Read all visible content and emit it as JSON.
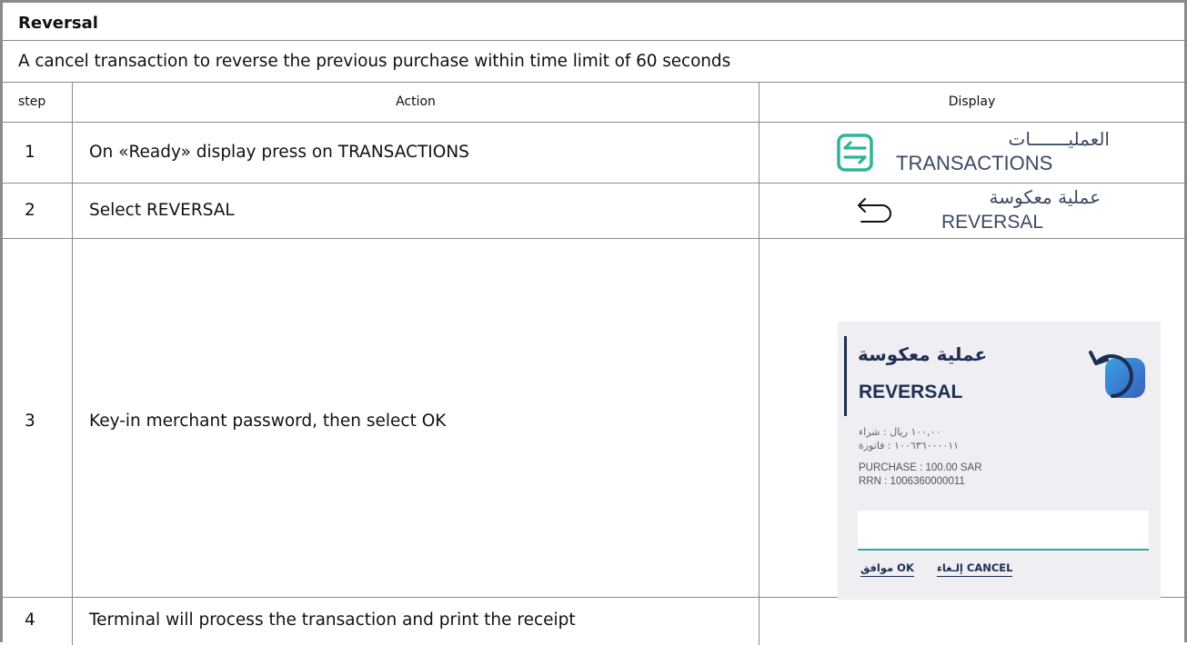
{
  "title": "Reversal",
  "description": "A cancel transaction to reverse the previous purchase within time limit of 60 seconds",
  "headers": {
    "step": "step",
    "action": "Action",
    "display": "Display"
  },
  "steps": [
    {
      "step": "1",
      "action": "On «Ready» display press on TRANSACTIONS"
    },
    {
      "step": "2",
      "action": "Select REVERSAL"
    },
    {
      "step": "3",
      "action": "Key-in merchant password, then select OK"
    },
    {
      "step": "4",
      "action": "Terminal will process the transaction and print the receipt"
    }
  ],
  "displays": {
    "transactions": {
      "arabic": "العمليـــــــات",
      "english": "TRANSACTIONS",
      "icon": "transactions-arrows-icon",
      "accent": "#2fb39a"
    },
    "reversal": {
      "arabic": "عملية معكوسة",
      "english": "REVERSAL",
      "icon": "undo-arrow-icon"
    },
    "terminal": {
      "arabic_title": "عملية معكوسة",
      "english_title": "REVERSAL",
      "arabic_purchase": "١٠٠,٠٠ ريال : شراء",
      "arabic_invoice": "١٠٠٦٣٦٠٠٠٠١١ : فاتورة",
      "purchase_line": "PURCHASE : 100.00 SAR",
      "rrn_line": "RRN : 1006360000011",
      "ok_button": "موافق OK",
      "cancel_button": "إلـغاء CANCEL",
      "icon": "return-arrow-icon",
      "brand_color": "#1e2d52",
      "accent_color": "#2fa896"
    }
  }
}
